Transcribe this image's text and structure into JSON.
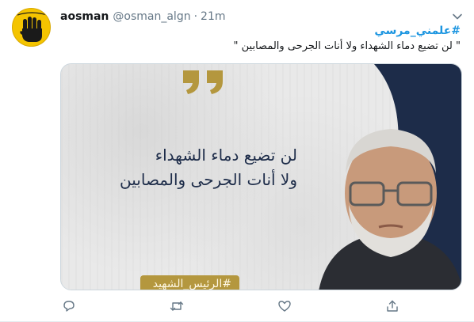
{
  "tweet": {
    "display_name": "aosman",
    "handle": "@osman_algn",
    "separator": "·",
    "time": "21m",
    "hashtag": "#علمني_مرسي",
    "quote_text": "\" لن تضيع دماء الشهداء ولا أنات الجرحى والمصابين \""
  },
  "media": {
    "line1": "لن تضيع دماء الشهداء",
    "line2": "ولا أنات الجرحى والمصابين",
    "band_text": "#الرئيس_الشهيد"
  },
  "actions": {
    "reply_icon": "reply-icon",
    "retweet_icon": "retweet-icon",
    "like_icon": "heart-icon",
    "share_icon": "share-icon"
  },
  "colors": {
    "link": "#1b95e0",
    "navy": "#1d2c49",
    "gold": "#b4973e",
    "avatar_yellow": "#f4c400",
    "muted": "#657786"
  }
}
